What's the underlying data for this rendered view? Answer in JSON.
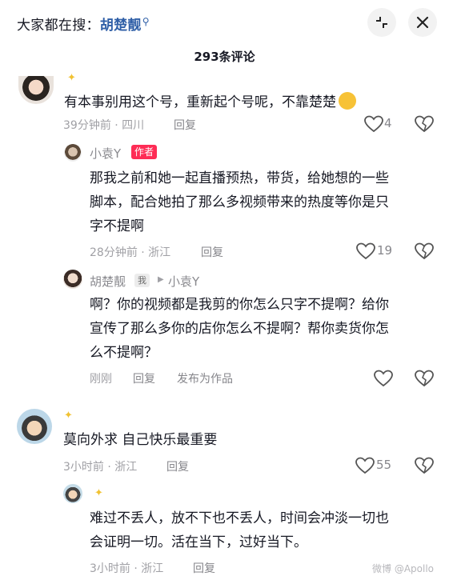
{
  "header": {
    "hot_search_prefix": "大家都在搜：",
    "hot_search_term": "胡楚靓",
    "hot_search_icon": "search-icon",
    "comment_count_title": "293条评论"
  },
  "comments": {
    "c1": {
      "text": "有本事别用这个号，重新起个号呢，不靠楚楚",
      "emoji": "laughing-tears-emoji",
      "time_location": "39分钟前 · 四川",
      "reply_label": "回复",
      "like_count": "4"
    },
    "r1": {
      "nickname": "小袁Y",
      "badge": "作者",
      "lines": [
        "那我之前和她一起直播预热，带货，给她想的一些",
        "脚本，配合她拍了那么多视频带来的热度等你是只",
        "字不提啊"
      ],
      "time_location": "28分钟前 · 浙江",
      "reply_label": "回复",
      "like_count": "19"
    },
    "r2": {
      "nickname": "胡楚靓",
      "badge": "我",
      "reply_to": "小袁Y",
      "lines": [
        "啊？你的视频都是我剪的你怎么只字不提啊？给你",
        "宣传了那么多你的店你怎么不提啊？帮你卖货你怎",
        "么不提啊？"
      ],
      "time": "刚刚",
      "reply_label": "回复",
      "publish_label": "发布为作品"
    },
    "c2": {
      "text": "莫向外求 自己快乐最重要",
      "time_location": "3小时前 · 浙江",
      "reply_label": "回复",
      "like_count": "55"
    },
    "r3": {
      "lines": [
        "难过不丢人，放不下也不丢人，时间会冲淡一切也",
        "会证明一切。活在当下，过好当下。"
      ],
      "time_location": "3小时前 · 浙江",
      "reply_label": "回复"
    }
  },
  "watermark": "微博 @Apollo"
}
